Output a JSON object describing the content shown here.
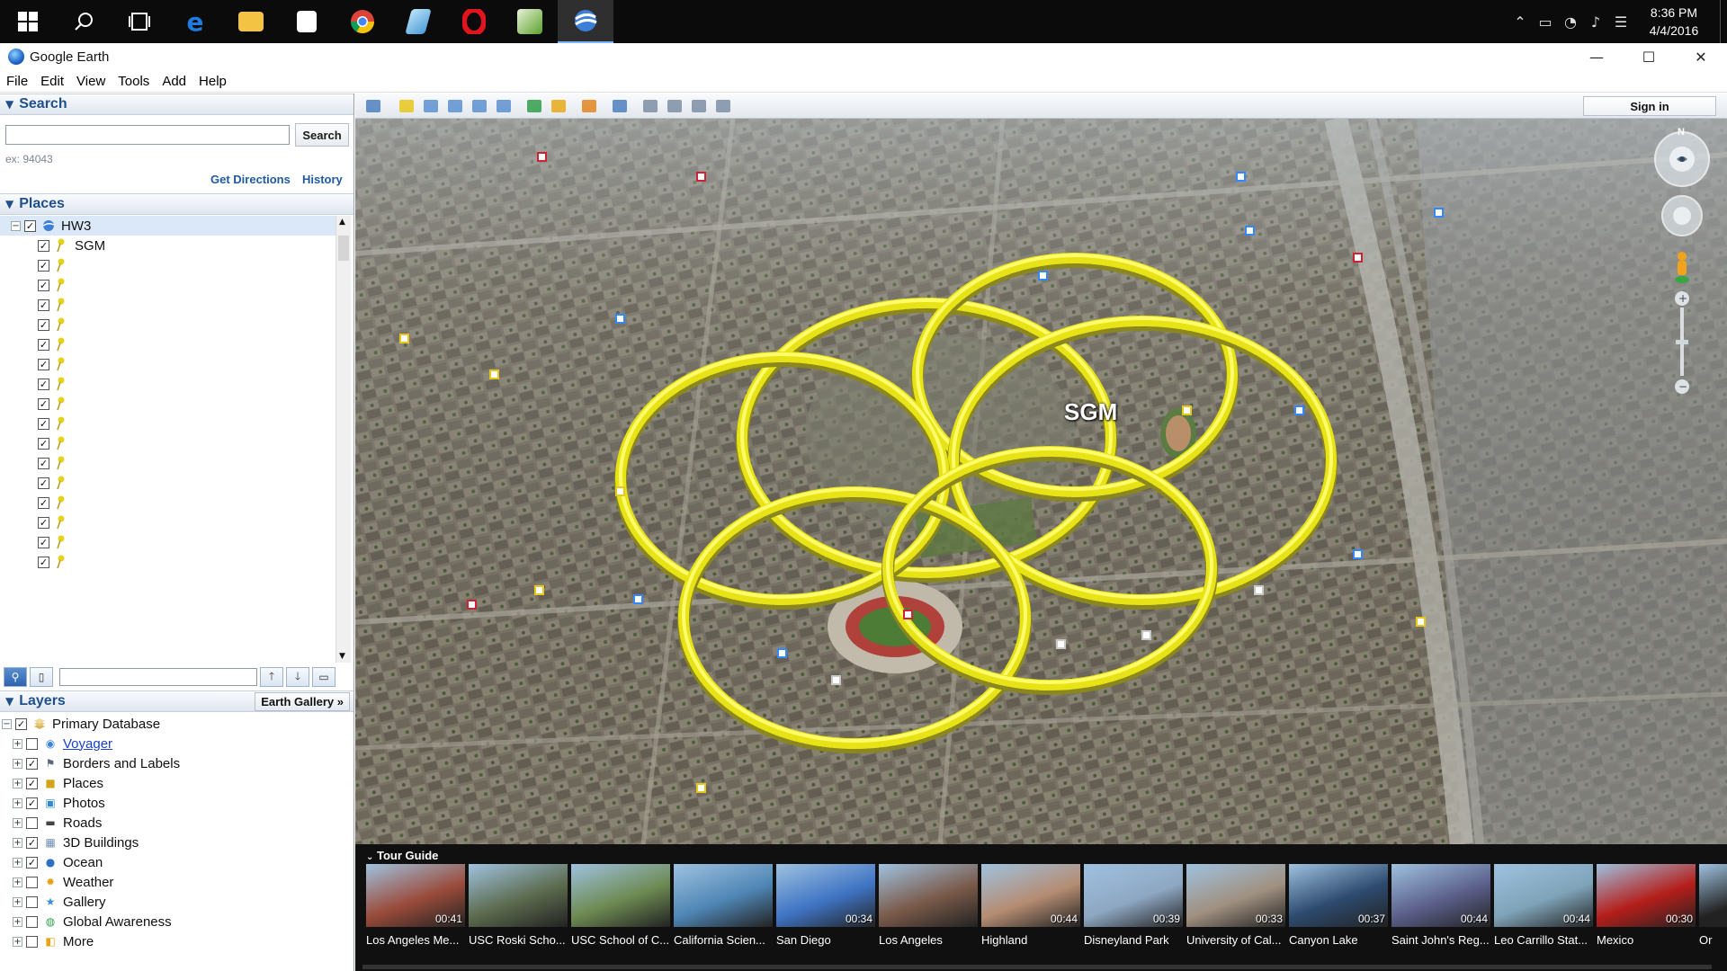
{
  "taskbar": {
    "icons": [
      {
        "name": "start-icon",
        "color": "#ffffff"
      },
      {
        "name": "search-icon",
        "color": "#ffffff"
      },
      {
        "name": "task-view-icon",
        "color": "#ffffff"
      },
      {
        "name": "edge-icon",
        "color": "#1e7be0"
      },
      {
        "name": "file-explorer-icon",
        "color": "#f3c443"
      },
      {
        "name": "store-icon",
        "color": "#ffffff"
      },
      {
        "name": "chrome-icon",
        "color": "#db4437"
      },
      {
        "name": "app-icon",
        "color": "#5ab0e6"
      },
      {
        "name": "opera-icon",
        "color": "#e0141e"
      },
      {
        "name": "photos-icon",
        "color": "#5aa02c"
      },
      {
        "name": "google-earth-taskbar-icon",
        "color": "#3b7fd9"
      }
    ],
    "time": "8:36 PM",
    "date": "4/4/2016"
  },
  "window": {
    "title": "Google Earth",
    "controls": {
      "minimize": "—",
      "maximize": "☐",
      "close": "✕"
    }
  },
  "menu": [
    "File",
    "Edit",
    "View",
    "Tools",
    "Add",
    "Help"
  ],
  "search": {
    "section_title": "Search",
    "input_value": "",
    "button_label": "Search",
    "hint": "ex: 94043",
    "get_directions": "Get Directions",
    "history": "History"
  },
  "places": {
    "section_title": "Places",
    "folder": "HW3",
    "items": [
      "SGM",
      "",
      "",
      "",
      "",
      "",
      "",
      "",
      "",
      "",
      "",
      "",
      "",
      "",
      "",
      "",
      ""
    ]
  },
  "layers": {
    "section_title": "Layers",
    "earth_gallery": "Earth Gallery »",
    "root": "Primary Database",
    "items": [
      {
        "label": "Voyager",
        "checked": false,
        "link": true,
        "icon": "voyager-icon",
        "icon_color": "#3b82d9"
      },
      {
        "label": "Borders and Labels",
        "checked": true,
        "link": false,
        "icon": "borders-icon",
        "icon_color": "#5a6a7a"
      },
      {
        "label": "Places",
        "checked": true,
        "link": false,
        "icon": "places-icon",
        "icon_color": "#d2a41c"
      },
      {
        "label": "Photos",
        "checked": true,
        "link": false,
        "icon": "photos-icon",
        "icon_color": "#2e8ad8"
      },
      {
        "label": "Roads",
        "checked": false,
        "link": false,
        "icon": "roads-icon",
        "icon_color": "#444444"
      },
      {
        "label": "3D Buildings",
        "checked": true,
        "link": false,
        "icon": "buildings-icon",
        "icon_color": "#6f8fb0"
      },
      {
        "label": "Ocean",
        "checked": true,
        "link": false,
        "icon": "ocean-icon",
        "icon_color": "#2f6fc2"
      },
      {
        "label": "Weather",
        "checked": false,
        "link": false,
        "icon": "weather-icon",
        "icon_color": "#e2a21a"
      },
      {
        "label": "Gallery",
        "checked": false,
        "link": false,
        "icon": "gallery-icon",
        "icon_color": "#3c8fdc"
      },
      {
        "label": "Global Awareness",
        "checked": false,
        "link": false,
        "icon": "global-awareness-icon",
        "icon_color": "#2f9d4a"
      },
      {
        "label": "More",
        "checked": false,
        "link": false,
        "icon": "more-icon",
        "icon_color": "#e6a317"
      }
    ]
  },
  "toolbar": {
    "sign_in": "Sign in"
  },
  "map": {
    "placemark_label": "SGM",
    "ring_color": "#e7e316",
    "compass_letter": "N"
  },
  "tour_guide": {
    "title": "Tour Guide",
    "items": [
      {
        "label": "Los Angeles Me...",
        "duration": "00:41",
        "color": "#9a4b3a"
      },
      {
        "label": "USC Roski Scho...",
        "duration": "",
        "color": "#5c6b4e"
      },
      {
        "label": "USC School of C...",
        "duration": "",
        "color": "#6d8a52"
      },
      {
        "label": "California Scien...",
        "duration": "",
        "color": "#4f86b5"
      },
      {
        "label": "San Diego",
        "duration": "00:34",
        "color": "#3f74c4"
      },
      {
        "label": "Los Angeles",
        "duration": "",
        "color": "#7a5a4a"
      },
      {
        "label": "Highland",
        "duration": "00:44",
        "color": "#b58c72"
      },
      {
        "label": "Disneyland Park",
        "duration": "00:39",
        "color": "#8ea7c2"
      },
      {
        "label": "University of Cal...",
        "duration": "00:33",
        "color": "#a09080"
      },
      {
        "label": "Canyon Lake",
        "duration": "00:37",
        "color": "#2d4a6e"
      },
      {
        "label": "Saint John's Reg...",
        "duration": "00:44",
        "color": "#5b5f8a"
      },
      {
        "label": "Leo Carrillo Stat...",
        "duration": "00:44",
        "color": "#7fa3b8"
      },
      {
        "label": "Mexico",
        "duration": "00:30",
        "color": "#b51e1a"
      },
      {
        "label": "Or",
        "duration": "",
        "color": "#222222"
      }
    ]
  }
}
